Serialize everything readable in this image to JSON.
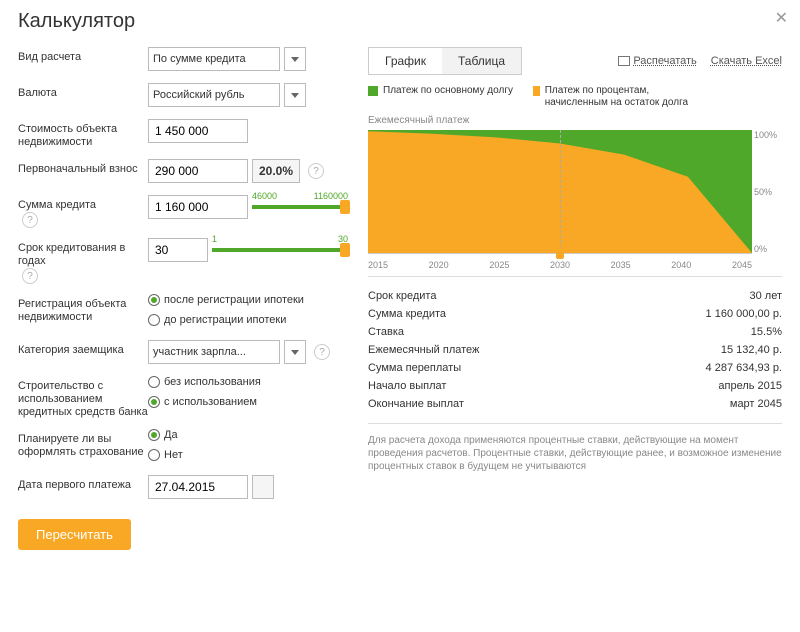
{
  "title": "Калькулятор",
  "close": "✕",
  "form": {
    "calc_type": {
      "label": "Вид расчета",
      "value": "По сумме кредита"
    },
    "currency": {
      "label": "Валюта",
      "value": "Российский рубль"
    },
    "property_cost": {
      "label": "Стоимость объекта недвижимости",
      "value": "1 450 000"
    },
    "down_payment": {
      "label": "Первоначальный взнос",
      "value": "290 000",
      "pct": "20.0%"
    },
    "loan_sum": {
      "label": "Сумма кредита",
      "value": "1 160 000",
      "min": "46000",
      "max": "1160000"
    },
    "term": {
      "label": "Срок кредитования в годах",
      "value": "30",
      "min": "1",
      "max": "30"
    },
    "registration": {
      "label": "Регистрация объекта недвижимости",
      "opt1": "после регистрации ипотеки",
      "opt2": "до регистрации ипотеки",
      "selected": 0
    },
    "borrower_cat": {
      "label": "Категория заемщика",
      "value": "участник зарпла..."
    },
    "bank_funds": {
      "label": "Строительство с использованием кредитных средств банка",
      "opt1": "без использования",
      "opt2": "с использованием",
      "selected": 1
    },
    "insurance": {
      "label": "Планируете ли вы оформлять страхование",
      "opt1": "Да",
      "opt2": "Нет",
      "selected": 0
    },
    "first_payment": {
      "label": "Дата первого платежа",
      "value": "27.04.2015"
    },
    "recalc": "Пересчитать"
  },
  "tabs": {
    "chart": "График",
    "table": "Таблица"
  },
  "links": {
    "print": "Распечатать",
    "excel": "Скачать Excel"
  },
  "legend": {
    "principal": "Платеж по основному долгу",
    "interest": "Платеж по процентам, начисленным на остаток долга"
  },
  "chart_data": {
    "type": "area",
    "title": "Ежемесячный платеж",
    "xlabel": "",
    "ylabel": "",
    "x": [
      2015,
      2020,
      2025,
      2030,
      2035,
      2040,
      2045
    ],
    "ylim": [
      0,
      100
    ],
    "yticks": [
      "100%",
      "50%",
      "0%"
    ],
    "xticks": [
      "2015",
      "2020",
      "2025",
      "2030",
      "2035",
      "2040",
      "2045"
    ],
    "series": [
      {
        "name": "Платеж по процентам, начисленным на остаток долга",
        "color": "#f9a825",
        "values": [
          99,
          97,
          94,
          89,
          80,
          62,
          0
        ]
      },
      {
        "name": "Платеж по основному долгу",
        "color": "#4fa82a",
        "values": [
          1,
          3,
          6,
          11,
          20,
          38,
          100
        ]
      }
    ],
    "marker_x": 2030
  },
  "summary": {
    "rows": [
      {
        "k": "Срок кредита",
        "v": "30 лет"
      },
      {
        "k": "Сумма кредита",
        "v": "1 160 000,00 р."
      },
      {
        "k": "Ставка",
        "v": "15.5%"
      },
      {
        "k": "Ежемесячный платеж",
        "v": "15 132,40 р."
      },
      {
        "k": "Сумма переплаты",
        "v": "4 287 634,93 р."
      },
      {
        "k": "Начало выплат",
        "v": "апрель 2015"
      },
      {
        "k": "Окончание выплат",
        "v": "март 2045"
      }
    ]
  },
  "disclaimer": "Для расчета дохода применяются процентные ставки, действующие на момент проведения расчетов. Процентные ставки, действующие ранее, и возможное изменение процентных ставок в будущем не учитываются"
}
